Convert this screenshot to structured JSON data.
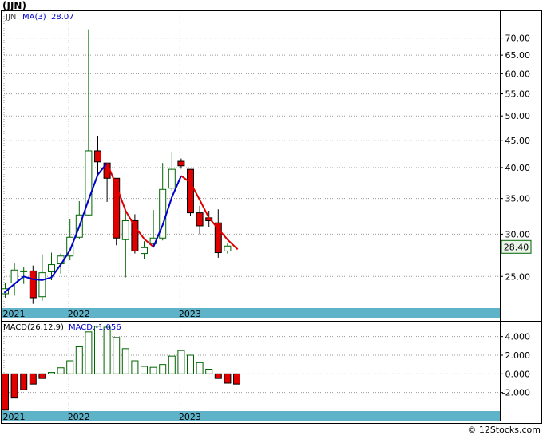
{
  "title": "(JJN)",
  "watermark": "© 12Stocks.com",
  "chart_data": [
    {
      "type": "candlestick",
      "panel": "price",
      "legend": {
        "symbol": "JJN",
        "ma_label": "MA(3)",
        "ma_value": "28.07"
      },
      "last_price": "28.40",
      "y_scale": "log",
      "ylim": [
        21.8,
        78.6
      ],
      "y_ticks": [
        25,
        30,
        35,
        40,
        45,
        50,
        55,
        60,
        65,
        70
      ],
      "y_tick_labels": [
        "25.00",
        "30.00",
        "35.00",
        "40.00",
        "45.00",
        "50.00",
        "55.00",
        "60.00",
        "65.00",
        "70.00"
      ],
      "x_labels": [
        {
          "label": "2021",
          "index": 0
        },
        {
          "label": "2022",
          "index": 7
        },
        {
          "label": "2023",
          "index": 19
        }
      ],
      "grid": true,
      "candles": [
        {
          "o": 23.2,
          "h": 24.3,
          "l": 22.8,
          "c": 23.7
        },
        {
          "o": 24.3,
          "h": 26.5,
          "l": 23.0,
          "c": 25.7
        },
        {
          "o": 25.6,
          "h": 26.0,
          "l": 24.2,
          "c": 25.6
        },
        {
          "o": 25.6,
          "h": 26.2,
          "l": 22.2,
          "c": 22.8
        },
        {
          "o": 22.9,
          "h": 27.5,
          "l": 22.5,
          "c": 25.4
        },
        {
          "o": 25.5,
          "h": 27.7,
          "l": 24.6,
          "c": 26.3
        },
        {
          "o": 26.4,
          "h": 27.6,
          "l": 25.3,
          "c": 27.3
        },
        {
          "o": 27.3,
          "h": 32.0,
          "l": 26.8,
          "c": 29.6
        },
        {
          "o": 29.6,
          "h": 34.6,
          "l": 29.4,
          "c": 32.6
        },
        {
          "o": 32.6,
          "h": 72.7,
          "l": 32.4,
          "c": 43.0
        },
        {
          "o": 43.0,
          "h": 45.8,
          "l": 38.8,
          "c": 41.0
        },
        {
          "o": 40.8,
          "h": 40.8,
          "l": 34.5,
          "c": 38.2
        },
        {
          "o": 38.2,
          "h": 38.2,
          "l": 28.6,
          "c": 29.5
        },
        {
          "o": 29.3,
          "h": 33.2,
          "l": 24.9,
          "c": 31.8
        },
        {
          "o": 31.8,
          "h": 32.7,
          "l": 27.6,
          "c": 27.9
        },
        {
          "o": 27.6,
          "h": 29.1,
          "l": 27.0,
          "c": 28.3
        },
        {
          "o": 28.8,
          "h": 33.3,
          "l": 28.3,
          "c": 29.5
        },
        {
          "o": 29.5,
          "h": 40.8,
          "l": 29.2,
          "c": 36.4
        },
        {
          "o": 36.6,
          "h": 42.8,
          "l": 36.2,
          "c": 39.7
        },
        {
          "o": 41.1,
          "h": 41.6,
          "l": 39.8,
          "c": 40.3
        },
        {
          "o": 39.7,
          "h": 39.7,
          "l": 32.5,
          "c": 32.9
        },
        {
          "o": 32.9,
          "h": 33.9,
          "l": 30.0,
          "c": 31.1
        },
        {
          "o": 32.2,
          "h": 33.2,
          "l": 30.9,
          "c": 31.8
        },
        {
          "o": 31.5,
          "h": 33.4,
          "l": 27.1,
          "c": 27.7
        },
        {
          "o": 27.9,
          "h": 28.8,
          "l": 27.6,
          "c": 28.5
        }
      ],
      "ma_segments": [
        {
          "color": "#0000cc",
          "points": [
            {
              "i": -0.1,
              "v": 23.3
            },
            {
              "i": 1,
              "v": 24.2
            },
            {
              "i": 2,
              "v": 25.0
            },
            {
              "i": 3,
              "v": 24.7
            },
            {
              "i": 4,
              "v": 24.6
            },
            {
              "i": 5,
              "v": 24.9
            },
            {
              "i": 6,
              "v": 26.3
            },
            {
              "i": 7,
              "v": 28.0
            },
            {
              "i": 8,
              "v": 31.0
            },
            {
              "i": 9,
              "v": 34.8
            },
            {
              "i": 10,
              "v": 38.8
            },
            {
              "i": 11,
              "v": 40.8
            }
          ]
        },
        {
          "color": "#dd0000",
          "points": [
            {
              "i": 11,
              "v": 40.8
            },
            {
              "i": 12,
              "v": 37.0
            },
            {
              "i": 13,
              "v": 33.2
            },
            {
              "i": 14,
              "v": 31.0
            },
            {
              "i": 15,
              "v": 29.4
            },
            {
              "i": 16,
              "v": 28.4
            }
          ]
        },
        {
          "color": "#0000cc",
          "points": [
            {
              "i": 16,
              "v": 28.4
            },
            {
              "i": 17,
              "v": 31.2
            },
            {
              "i": 18,
              "v": 35.2
            },
            {
              "i": 19,
              "v": 38.6
            }
          ]
        },
        {
          "color": "#dd0000",
          "points": [
            {
              "i": 19,
              "v": 38.6
            },
            {
              "i": 20,
              "v": 37.5
            },
            {
              "i": 21,
              "v": 34.8
            },
            {
              "i": 22,
              "v": 32.2
            },
            {
              "i": 23,
              "v": 30.7
            },
            {
              "i": 24,
              "v": 29.3
            },
            {
              "i": 25.1,
              "v": 28.1
            }
          ]
        }
      ]
    },
    {
      "type": "bar",
      "panel": "macd",
      "legend": {
        "label": "MACD(26,12,9)",
        "value_label": "MACD:-1.056"
      },
      "ylim": [
        -4.0,
        5.6
      ],
      "y_ticks": [
        -2,
        0,
        2,
        4
      ],
      "y_tick_labels": [
        "-2.000",
        "0.000",
        "2.000",
        "4.000"
      ],
      "x_labels": [
        {
          "label": "2021",
          "index": 0
        },
        {
          "label": "2022",
          "index": 7
        },
        {
          "label": "2023",
          "index": 19
        }
      ],
      "values": [
        -3.9,
        -2.6,
        -1.7,
        -1.1,
        -0.5,
        0.15,
        0.65,
        1.4,
        2.9,
        4.5,
        5.1,
        5.0,
        3.9,
        2.7,
        1.4,
        0.8,
        0.7,
        1.0,
        1.9,
        2.5,
        2.0,
        1.2,
        0.5,
        -0.5,
        -1.0,
        -1.1
      ]
    }
  ]
}
